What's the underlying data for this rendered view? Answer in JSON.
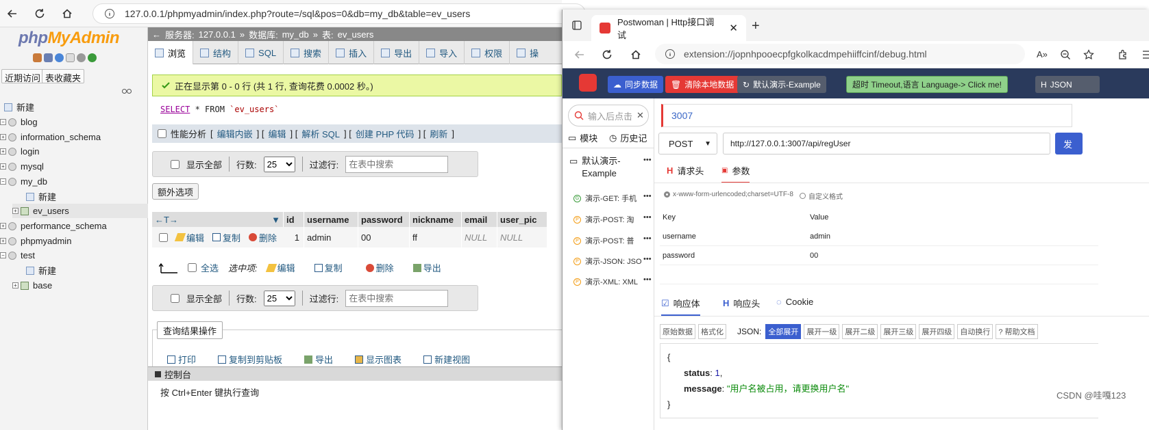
{
  "left_browser": {
    "url": "127.0.0.1/phpmyadmin/index.php?route=/sql&pos=0&db=my_db&table=ev_users"
  },
  "pma": {
    "logo_php": "php",
    "logo_myadmin": "MyAdmin",
    "recent_btn": "近期访问",
    "fav_btn": "表收藏夹",
    "tree": [
      "新建",
      "blog",
      "information_schema",
      "login",
      "mysql",
      "my_db",
      "新建",
      "ev_users",
      "performance_schema",
      "phpmyadmin",
      "test",
      "新建",
      "base"
    ],
    "breadcrumb": {
      "server_label": "服务器:",
      "server": "127.0.0.1",
      "db_label": "数据库:",
      "db": "my_db",
      "table_label": "表:",
      "table": "ev_users"
    },
    "tabs": [
      "浏览",
      "结构",
      "SQL",
      "搜索",
      "插入",
      "导出",
      "导入",
      "权限",
      "操"
    ],
    "success_msg": "正在显示第 0 - 0 行 (共 1 行, 查询花费 0.0002 秒。)",
    "sql": {
      "select": "SELECT",
      "rest": " * FROM ",
      "table": "`ev_users`"
    },
    "profiling": "性能分析",
    "query_links": [
      "编辑内嵌",
      "编辑",
      "解析 SQL",
      "创建 PHP 代码",
      "刷新"
    ],
    "show_all": "显示全部",
    "rows_label": "行数:",
    "rows_value": "25",
    "filter_label": "过滤行:",
    "filter_placeholder": "在表中搜索",
    "extra_options": "额外选项",
    "columns": [
      "id",
      "username",
      "password",
      "nickname",
      "email",
      "user_pic"
    ],
    "row_actions": {
      "edit": "编辑",
      "copy": "复制",
      "delete": "删除"
    },
    "row": {
      "id": "1",
      "username": "admin",
      "password": "00",
      "nickname": "ff",
      "email": "NULL",
      "user_pic": "NULL"
    },
    "bulk": {
      "select_all": "全选",
      "with_selected": "选中项:",
      "edit": "编辑",
      "copy": "复制",
      "delete": "删除",
      "export": "导出"
    },
    "query_ops_title": "查询结果操作",
    "query_ops": [
      "打印",
      "复制到剪贴板",
      "导出",
      "显示图表",
      "新建视图"
    ],
    "console_title": "控制台",
    "console_hint": "按 Ctrl+Enter 键执行查询"
  },
  "postwoman": {
    "tab_title": "Postwoman | Http接口调试",
    "url": "extension://jopnhpooecpfgkolkacdmpehiiffcinf/debug.html",
    "header_buttons": [
      "同步数据",
      "清除本地数据",
      "默认演示-Example",
      "超时 Timeout,语言 Language-> Click me!",
      "JSON"
    ],
    "search_placeholder": "输入后点击",
    "left_tabs": [
      "模块",
      "历史记"
    ],
    "group": "默认演示-Example",
    "items": [
      "演示-GET: 手机",
      "演示-POST: 淘",
      "演示-POST: 普",
      "演示-JSON: JSO",
      "演示-XML: XML"
    ],
    "port": "3007",
    "method": "POST",
    "request_url": "http://127.0.0.1:3007/api/regUser",
    "send": "发",
    "req_tabs": [
      "请求头",
      "参数"
    ],
    "body_opt1": "x-www-form-urlencoded;charset=UTF-8",
    "body_opt2": "自定义格式",
    "kv_key_header": "Key",
    "kv_value_header": "Value",
    "params": [
      {
        "k": "username",
        "v": "admin"
      },
      {
        "k": "password",
        "v": "00"
      }
    ],
    "resp_tabs": [
      "响应体",
      "响应头",
      "Cookie"
    ],
    "fmt_raw": "原始数据",
    "fmt_format": "格式化",
    "json_label": "JSON:",
    "fmt_buttons": [
      "全部展开",
      "展开一级",
      "展开二级",
      "展开三级",
      "展开四级",
      "自动换行"
    ],
    "help": "帮助文档",
    "response": {
      "status_key": "status",
      "status_val": "1",
      "message_key": "message",
      "message_val": "\"用户名被占用，请更换用户名\""
    }
  },
  "watermark": "CSDN @哇嘎123"
}
